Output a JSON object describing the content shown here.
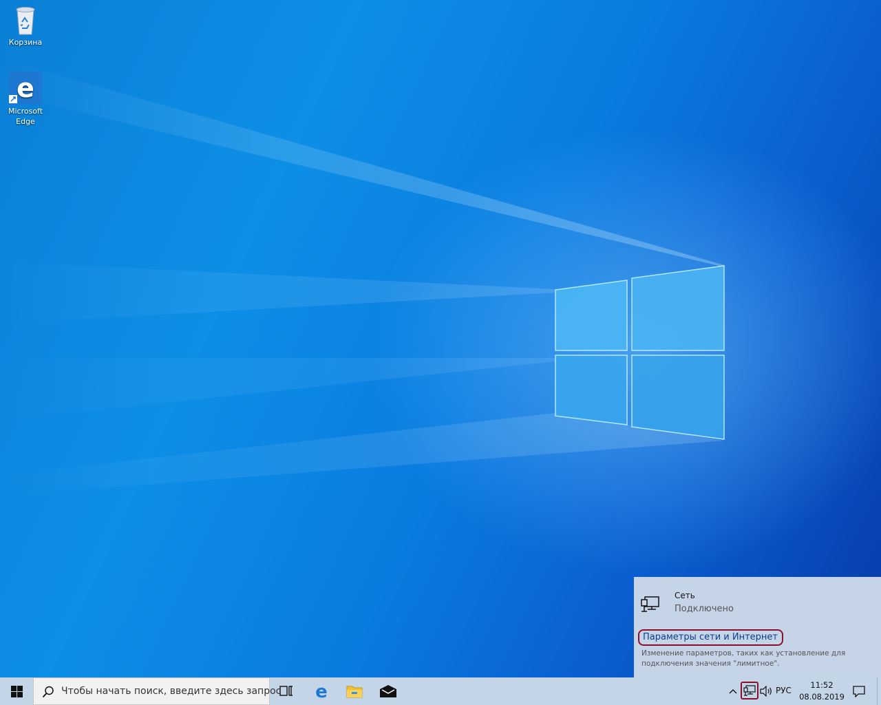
{
  "desktop": {
    "icons": [
      {
        "label": "Корзина",
        "icon": "recycle-bin-icon"
      },
      {
        "label": "Microsoft Edge",
        "icon": "edge-icon"
      }
    ]
  },
  "network_flyout": {
    "network_name": "Сеть",
    "network_status": "Подключено",
    "settings_link": "Параметры сети и Интернет",
    "settings_description": "Изменение параметров, таких как установление для подключения значения \"лимитное\"."
  },
  "taskbar": {
    "search_placeholder": "Чтобы начать поиск, введите здесь запрос",
    "pinned": [
      "task-view-icon",
      "edge-icon",
      "file-explorer-icon",
      "mail-icon"
    ],
    "tray": {
      "language": "РУС",
      "time": "11:52",
      "date": "08.08.2019"
    }
  },
  "colors": {
    "highlight_border": "#8b0f2c",
    "link": "#0a3f8c",
    "taskbar": "#c5d5e8"
  }
}
